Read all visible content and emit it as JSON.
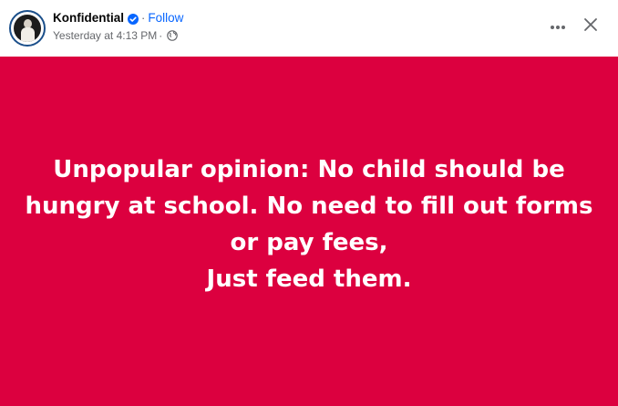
{
  "post": {
    "author": "Konfidential",
    "separator": "·",
    "follow_label": "Follow",
    "timestamp": "Yesterday at 4:13 PM",
    "meta_separator": "·",
    "audience_icon": "globe-icon",
    "verified_icon": "verified-badge-icon",
    "menu_icon": "more-horizontal-icon",
    "close_icon": "close-icon"
  },
  "image": {
    "background_color": "#dc003f",
    "text_color": "#ffffff",
    "lines": [
      "Unpopular opinion: No child should be",
      "hungry at school. No need to fill out forms",
      "or pay fees,",
      "Just feed them."
    ]
  },
  "colors": {
    "link": "#0866ff",
    "secondary_text": "#65676b",
    "primary_text": "#050505"
  }
}
